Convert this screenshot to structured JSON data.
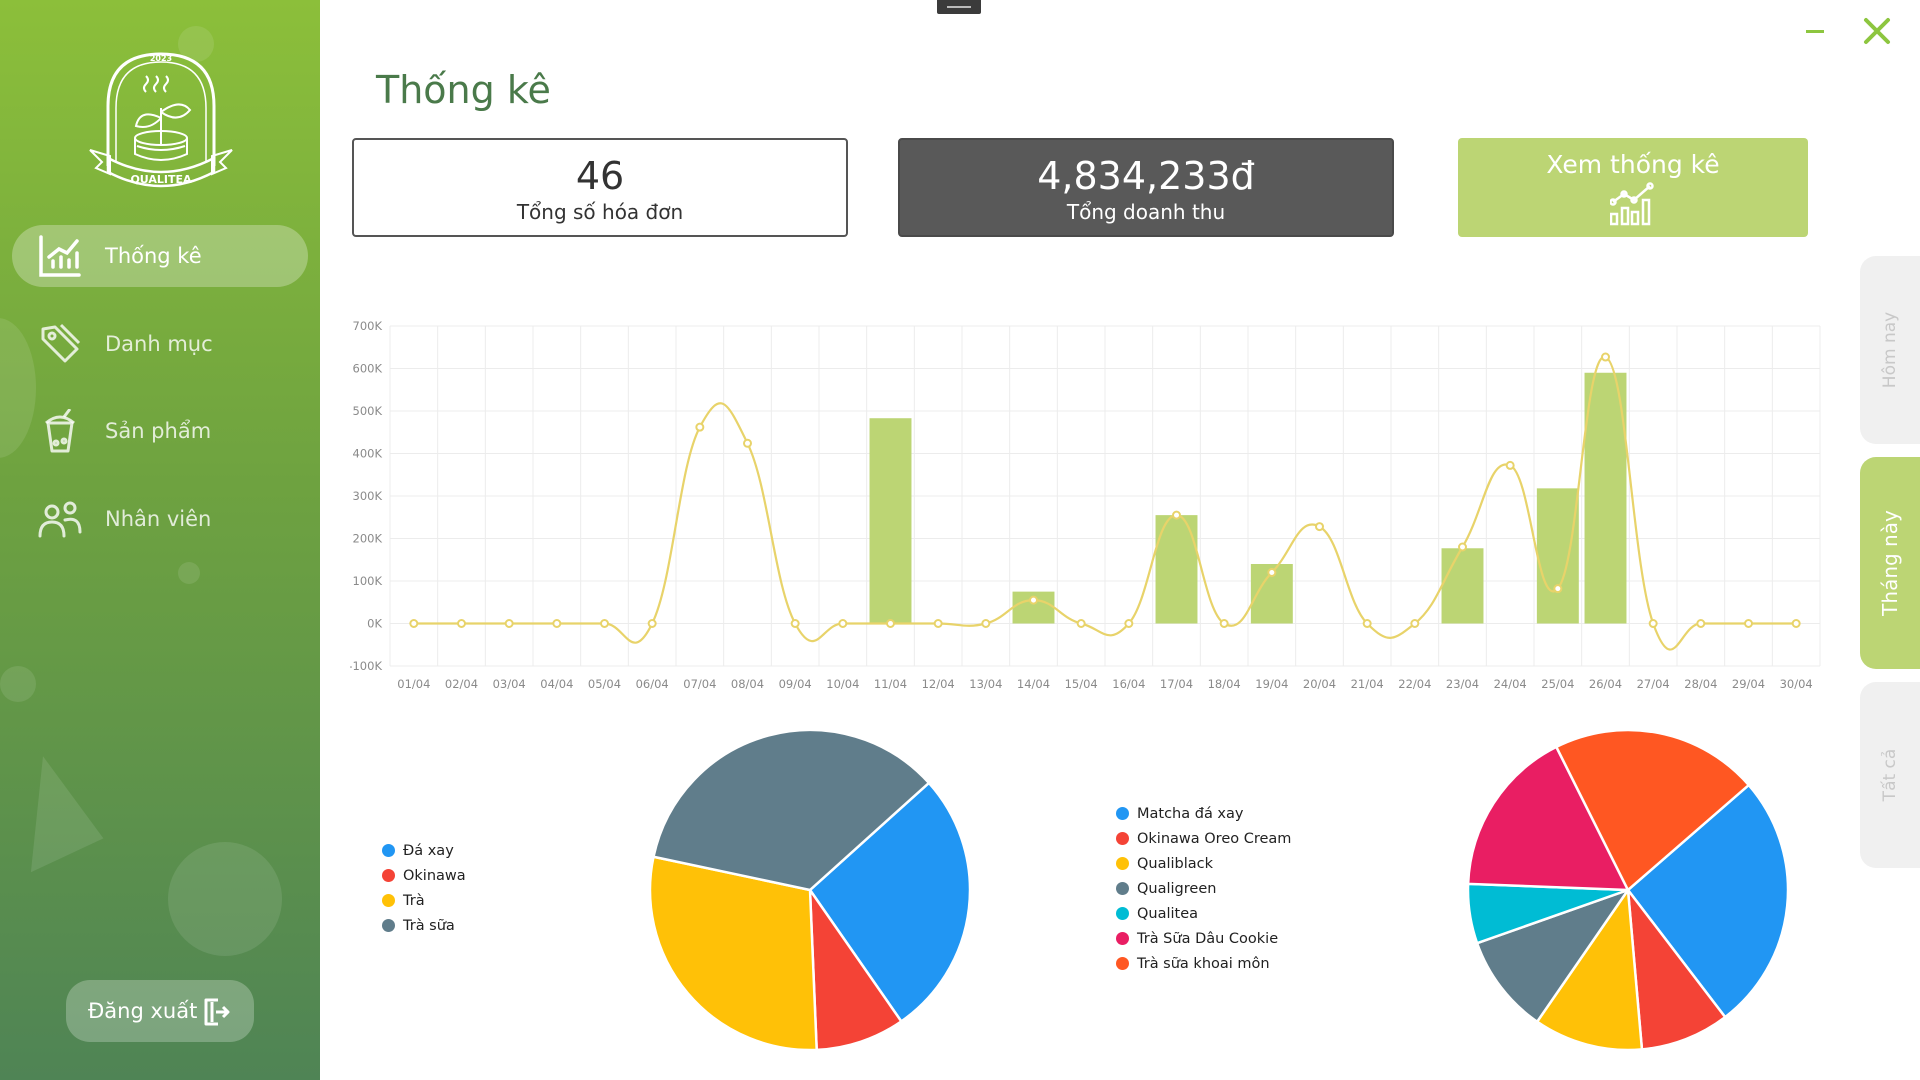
{
  "app": {
    "logo": {
      "text": "QUALITEA",
      "year": "2023"
    },
    "nav": [
      {
        "id": "stats",
        "label": "Thống kê",
        "icon": "chart-icon",
        "active": true
      },
      {
        "id": "categories",
        "label": "Danh mục",
        "icon": "tag-icon",
        "active": false
      },
      {
        "id": "products",
        "label": "Sản phẩm",
        "icon": "cup-icon",
        "active": false
      },
      {
        "id": "staff",
        "label": "Nhân viên",
        "icon": "people-icon",
        "active": false
      }
    ],
    "logout_label": "Đăng xuất"
  },
  "page": {
    "title": "Thống kê"
  },
  "cards": {
    "invoices": {
      "value": "46",
      "label": "Tổng số hóa đơn"
    },
    "revenue": {
      "value": "4,834,233đ",
      "label": "Tổng doanh thu"
    }
  },
  "view_button": {
    "label": "Xem thống kê"
  },
  "range_tabs": [
    {
      "label": "Hôm nay",
      "active": false
    },
    {
      "label": "Tháng này",
      "active": true
    },
    {
      "label": "Tất cả",
      "active": false
    }
  ],
  "colors": {
    "accent": "#8dc63f",
    "bar": "#bcd574",
    "line": "#e8d36a",
    "dark_card": "#595959"
  },
  "chart_data": [
    {
      "type": "bar",
      "overlay": "line",
      "categories": [
        "01/04",
        "02/04",
        "03/04",
        "04/04",
        "05/04",
        "06/04",
        "07/04",
        "08/04",
        "09/04",
        "10/04",
        "11/04",
        "12/04",
        "13/04",
        "14/04",
        "15/04",
        "16/04",
        "17/04",
        "18/04",
        "19/04",
        "20/04",
        "21/04",
        "22/04",
        "23/04",
        "24/04",
        "25/04",
        "26/04",
        "27/04",
        "28/04",
        "29/04",
        "30/04"
      ],
      "bar_values": [
        0,
        0,
        0,
        0,
        0,
        0,
        0,
        0,
        0,
        0,
        483000,
        0,
        0,
        75000,
        0,
        0,
        255000,
        0,
        140000,
        0,
        0,
        0,
        177000,
        0,
        318000,
        590000,
        0,
        0,
        0,
        0
      ],
      "line_values": [
        0,
        0,
        0,
        0,
        0,
        0,
        462000,
        424000,
        0,
        0,
        0,
        0,
        0,
        55000,
        0,
        0,
        255000,
        0,
        120000,
        228000,
        0,
        0,
        180000,
        372000,
        82000,
        627000,
        0,
        0,
        0,
        0
      ],
      "ylim": [
        -100000,
        700000
      ],
      "yticks": [
        "-100K",
        "0K",
        "100K",
        "200K",
        "300K",
        "400K",
        "500K",
        "600K",
        "700K"
      ],
      "grid": true
    },
    {
      "type": "pie",
      "legend": [
        "Đá xay",
        "Okinawa",
        "Trà",
        "Trà sữa"
      ],
      "values": [
        27,
        9,
        29,
        35
      ],
      "colors": [
        "#2196f3",
        "#f44336",
        "#ffc107",
        "#607d8b"
      ],
      "legend_position": "left"
    },
    {
      "type": "pie",
      "legend": [
        "Matcha đá xay",
        "Okinawa Oreo Cream",
        "Qualiblack",
        "Qualigreen",
        "Qualitea",
        "Trà Sữa Dâu Cookie",
        "Trà sữa khoai môn"
      ],
      "values": [
        26,
        9,
        11,
        10,
        6,
        17,
        21
      ],
      "colors": [
        "#2196f3",
        "#f44336",
        "#ffc107",
        "#607d8b",
        "#00bcd4",
        "#e91e63",
        "#ff5722"
      ],
      "legend_position": "left"
    }
  ]
}
